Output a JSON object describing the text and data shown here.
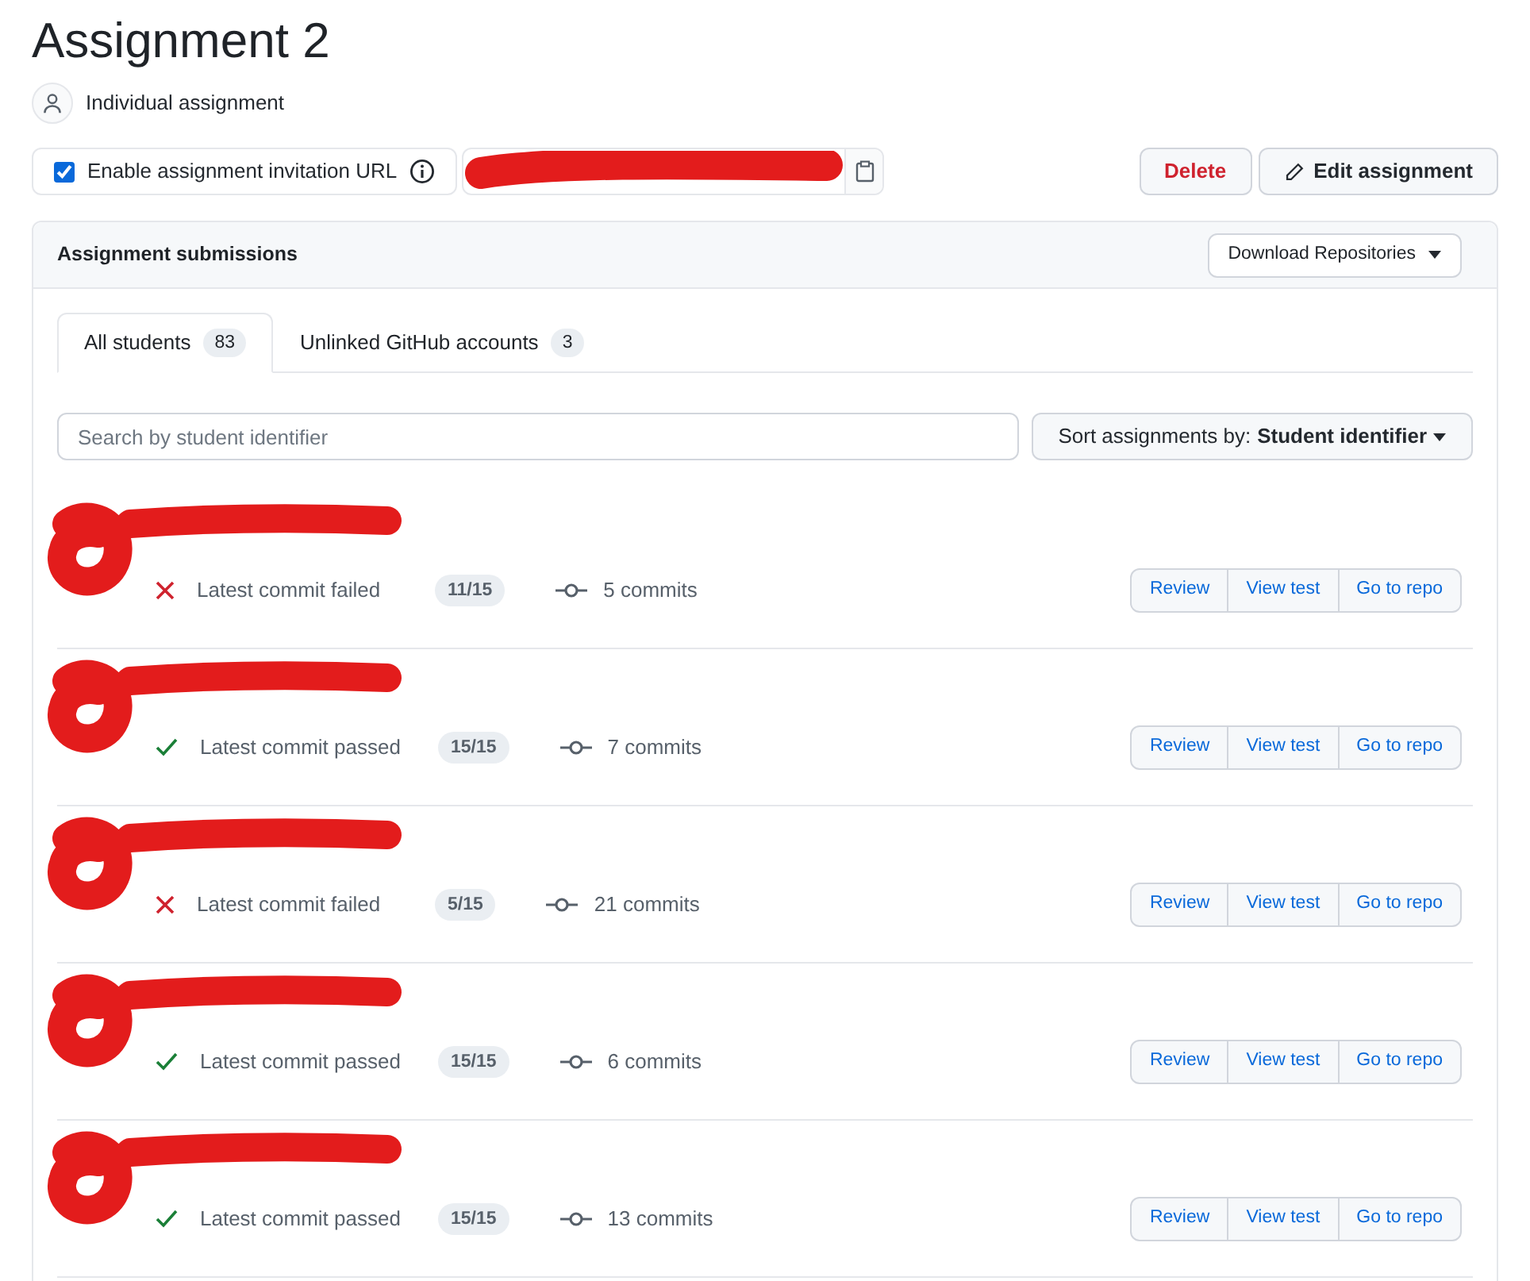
{
  "title": "Assignment 2",
  "assignment_type": "Individual assignment",
  "invitation": {
    "label": "Enable assignment invitation URL",
    "checked": true
  },
  "actions": [
    {
      "label": "Delete",
      "kind": "danger"
    },
    {
      "label": "Edit assignment",
      "kind": "edit"
    }
  ],
  "submissions": {
    "title": "Assignment submissions",
    "download_button": "Download Repositories",
    "tabs": [
      {
        "label": "All students",
        "count": "83",
        "selected": true
      },
      {
        "label": "Unlinked GitHub accounts",
        "count": "3",
        "selected": false
      }
    ],
    "search": {
      "placeholder": "Search by student identifier"
    },
    "sort": {
      "label": "Sort assignments by:",
      "value": "Student identifier"
    },
    "rows": [
      {
        "passed": false,
        "status": "Latest commit failed",
        "score": "11/15",
        "commits": "5 commits",
        "buttons": [
          "Review",
          "View test",
          "Go to repo"
        ]
      },
      {
        "passed": true,
        "status": "Latest commit passed",
        "score": "15/15",
        "commits": "7 commits",
        "buttons": [
          "Review",
          "View test",
          "Go to repo"
        ]
      },
      {
        "passed": false,
        "status": "Latest commit failed",
        "score": "5/15",
        "commits": "21 commits",
        "buttons": [
          "Review",
          "View test",
          "Go to repo"
        ]
      },
      {
        "passed": true,
        "status": "Latest commit passed",
        "score": "15/15",
        "commits": "6 commits",
        "buttons": [
          "Review",
          "View test",
          "Go to repo"
        ]
      },
      {
        "passed": true,
        "status": "Latest commit passed",
        "score": "15/15",
        "commits": "13 commits",
        "buttons": [
          "Review",
          "View test",
          "Go to repo"
        ]
      }
    ]
  }
}
